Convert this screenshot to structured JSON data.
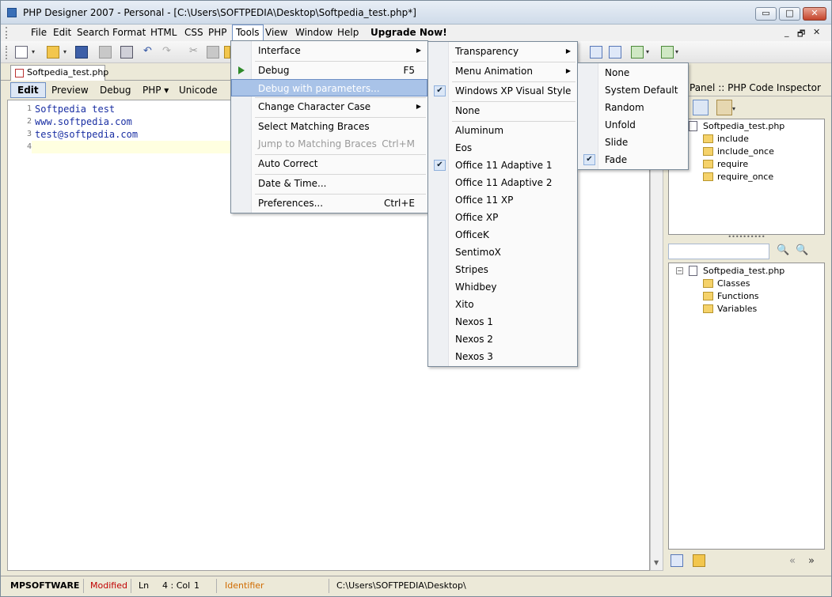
{
  "window": {
    "title": "PHP Designer 2007 - Personal - [C:\\Users\\SOFTPEDIA\\Desktop\\Softpedia_test.php*]",
    "min_glyph": "▭",
    "max_glyph": "□",
    "close_glyph": "✕"
  },
  "menubar": {
    "items": [
      "File",
      "Edit",
      "Search",
      "Format",
      "HTML",
      "CSS",
      "PHP",
      "Tools",
      "View",
      "Window",
      "Help",
      "Upgrade Now!"
    ],
    "mdi_min": "_",
    "mdi_max": "🗗",
    "mdi_close": "✕"
  },
  "toolbar": {
    "undo_glyph": "↶",
    "redo_glyph": "↷",
    "cut_glyph": "✂",
    "dropdown_glyph": "▾"
  },
  "document_tab": {
    "label": "Softpedia_test.php"
  },
  "mode_tabs": [
    "Edit",
    "Preview",
    "Debug",
    "PHP ▾",
    "Unicode"
  ],
  "editor": {
    "lines": [
      {
        "num": "1",
        "text": "Softpedia test"
      },
      {
        "num": "2",
        "text": "www.softpedia.com"
      },
      {
        "num": "3",
        "text": "test@softpedia.com"
      },
      {
        "num": "4",
        "text": ""
      }
    ],
    "scroll_up": "▲",
    "scroll_down": "▼"
  },
  "right_panel": {
    "title": "Panel :: PHP Code Inspector",
    "tree_top": {
      "root": "Softpedia_test.php",
      "children": [
        "include",
        "include_once",
        "require",
        "require_once"
      ]
    },
    "splitter": "••••••••••",
    "tree_bottom": {
      "root": "Softpedia_test.php",
      "children": [
        "Classes",
        "Functions",
        "Variables"
      ],
      "expander": "−"
    },
    "nav_prev": "«",
    "nav_next": "»",
    "search_glyph": "🔍"
  },
  "statusbar": {
    "brand": "MPSOFTWARE",
    "modified": "Modified",
    "ln": "Ln",
    "pos": "4 : Col",
    "col": "1",
    "identifier": "Identifier",
    "path": "C:\\Users\\SOFTPEDIA\\Desktop\\"
  },
  "tools_menu": {
    "items": [
      {
        "label": "Interface",
        "sub": "▶"
      },
      {
        "label": "Debug",
        "shortcut": "F5"
      },
      {
        "label": "Debug with parameters..."
      },
      {
        "label": "Change Character Case",
        "sub": "▶"
      },
      {
        "label": "Select Matching Braces"
      },
      {
        "label": "Jump to Matching Braces",
        "shortcut": "Ctrl+M"
      },
      {
        "label": "Auto Correct"
      },
      {
        "label": "Date & Time..."
      },
      {
        "label": "Preferences...",
        "shortcut": "Ctrl+E"
      }
    ]
  },
  "interface_menu": {
    "check": "✔",
    "items": [
      {
        "label": "Transparency",
        "sub": "▶"
      },
      {
        "label": "Menu Animation",
        "sub": "▶"
      },
      {
        "label": "Windows XP Visual Style"
      },
      {
        "label": "None"
      },
      {
        "label": "Aluminum"
      },
      {
        "label": "Eos"
      },
      {
        "label": "Office 11 Adaptive 1"
      },
      {
        "label": "Office 11 Adaptive 2"
      },
      {
        "label": "Office 11 XP"
      },
      {
        "label": "Office XP"
      },
      {
        "label": "OfficeK"
      },
      {
        "label": "SentimoX"
      },
      {
        "label": "Stripes"
      },
      {
        "label": "Whidbey"
      },
      {
        "label": "Xito"
      },
      {
        "label": "Nexos 1"
      },
      {
        "label": "Nexos 2"
      },
      {
        "label": "Nexos 3"
      }
    ]
  },
  "animation_menu": {
    "items": [
      "None",
      "System Default",
      "Random",
      "Unfold",
      "Slide",
      "Fade"
    ]
  }
}
